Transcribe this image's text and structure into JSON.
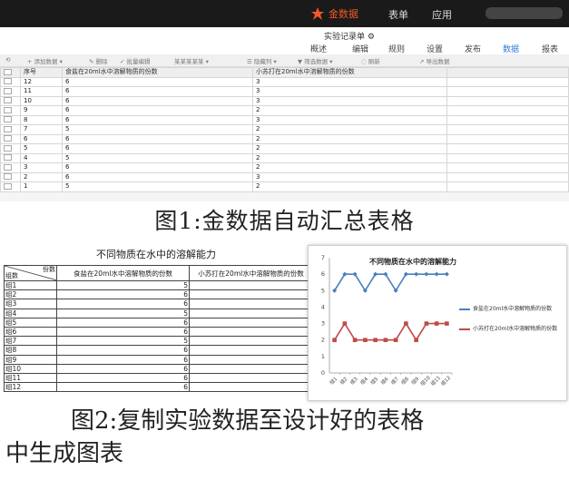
{
  "app": {
    "logo_text": "金数据",
    "nav": [
      "表单",
      "应用"
    ],
    "form_name": "实验记录单 ⚙",
    "tabs": [
      "概述",
      "编辑",
      "规则",
      "设置",
      "发布",
      "数据",
      "报表"
    ],
    "active_tab": "数据",
    "toolbar": [
      "+ 添加数据 ▾",
      "✎ 删除",
      "✓ 批量编辑",
      "某某某某某 ▾",
      "☰ 隐藏列 ▾",
      "▼ 筛选数据 ▾",
      "◌ 刷新",
      "↗ 导出数据"
    ],
    "columns": [
      "序号",
      "食盐在20ml水中溶解物质的份数",
      "小苏打在20ml水中溶解物质的份数"
    ],
    "rows": [
      {
        "id": "12",
        "salt": "6",
        "soda": "3"
      },
      {
        "id": "11",
        "salt": "6",
        "soda": "3"
      },
      {
        "id": "10",
        "salt": "6",
        "soda": "3"
      },
      {
        "id": "9",
        "salt": "6",
        "soda": "2"
      },
      {
        "id": "8",
        "salt": "6",
        "soda": "3"
      },
      {
        "id": "7",
        "salt": "5",
        "soda": "2"
      },
      {
        "id": "6",
        "salt": "6",
        "soda": "2"
      },
      {
        "id": "5",
        "salt": "6",
        "soda": "2"
      },
      {
        "id": "4",
        "salt": "5",
        "soda": "2"
      },
      {
        "id": "3",
        "salt": "6",
        "soda": "2"
      },
      {
        "id": "2",
        "salt": "6",
        "soda": "3"
      },
      {
        "id": "1",
        "salt": "5",
        "soda": "2"
      }
    ]
  },
  "caption1": "图1:金数据自动汇总表格",
  "table2": {
    "title": "不同物质在水中的溶解能力",
    "corner_top": "份数",
    "corner_bottom": "组数",
    "col_salt": "食盐在20ml水中溶解物质的份数",
    "col_soda": "小苏打在20ml水中溶解物质的份数",
    "rows": [
      {
        "group": "组1",
        "salt": "5",
        "soda": "2"
      },
      {
        "group": "组2",
        "salt": "6",
        "soda": "3"
      },
      {
        "group": "组3",
        "salt": "6",
        "soda": "2"
      },
      {
        "group": "组4",
        "salt": "5",
        "soda": "2"
      },
      {
        "group": "组5",
        "salt": "6",
        "soda": "2"
      },
      {
        "group": "组6",
        "salt": "6",
        "soda": "2"
      },
      {
        "group": "组7",
        "salt": "5",
        "soda": "2"
      },
      {
        "group": "组8",
        "salt": "6",
        "soda": "3"
      },
      {
        "group": "组9",
        "salt": "6",
        "soda": "2"
      },
      {
        "group": "组10",
        "salt": "6",
        "soda": "3"
      },
      {
        "group": "组11",
        "salt": "6",
        "soda": "3"
      },
      {
        "group": "组12",
        "salt": "6",
        "soda": "3"
      }
    ]
  },
  "chart_data": {
    "type": "line",
    "title": "不同物质在水中的溶解能力",
    "categories": [
      "组1",
      "组2",
      "组3",
      "组4",
      "组5",
      "组6",
      "组7",
      "组8",
      "组9",
      "组10",
      "组11",
      "组12"
    ],
    "series": [
      {
        "name": "食盐在20ml水中溶解物质的份数",
        "values": [
          5,
          6,
          6,
          5,
          6,
          6,
          5,
          6,
          6,
          6,
          6,
          6
        ],
        "color": "#4a7ebb"
      },
      {
        "name": "小苏打在20ml水中溶解物质的份数",
        "values": [
          2,
          3,
          2,
          2,
          2,
          2,
          2,
          3,
          2,
          3,
          3,
          3
        ],
        "color": "#be4b48"
      }
    ],
    "ylim": [
      0,
      7
    ],
    "yticks": [
      0,
      1,
      2,
      3,
      4,
      5,
      6,
      7
    ],
    "grid": false,
    "legend": "right"
  },
  "caption2_line1": "图2:复制实验数据至设计好的表格",
  "caption2_line2": "中生成图表",
  "colors": {
    "brand": "#f05a28",
    "topbar": "#1a1a1a",
    "accent": "#2a7bd8"
  }
}
